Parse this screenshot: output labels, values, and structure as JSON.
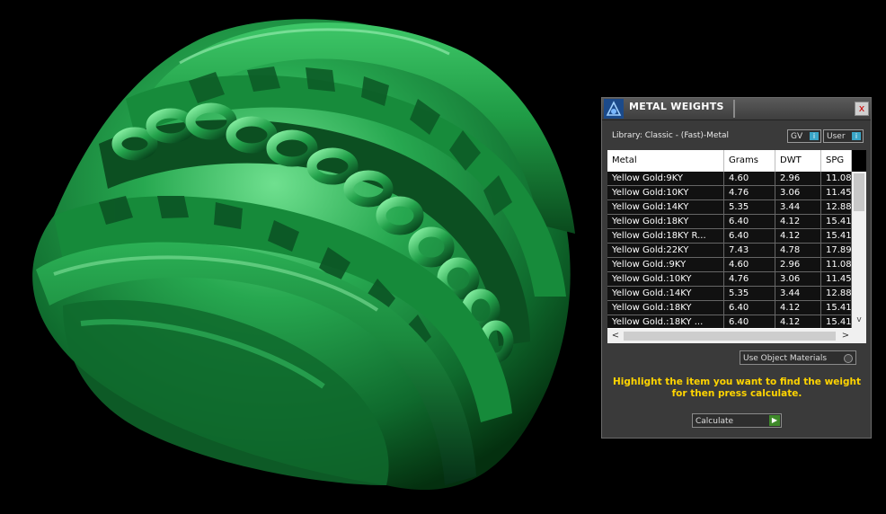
{
  "panel": {
    "title": "METAL WEIGHTS",
    "close_label": "x",
    "library_text": "Library: Classic - (Fast)-Metal",
    "gv_label": "GV",
    "user_label": "User",
    "toggle_icon": "i",
    "table": {
      "columns": [
        "Metal",
        "Grams",
        "DWT",
        "SPG"
      ],
      "rows": [
        [
          "Yellow Gold:9KY",
          "4.60",
          "2.96",
          "11.08"
        ],
        [
          "Yellow Gold:10KY",
          "4.76",
          "3.06",
          "11.45"
        ],
        [
          "Yellow Gold:14KY",
          "5.35",
          "3.44",
          "12.88"
        ],
        [
          "Yellow Gold:18KY",
          "6.40",
          "4.12",
          "15.41"
        ],
        [
          "Yellow Gold:18KY R...",
          "6.40",
          "4.12",
          "15.41"
        ],
        [
          "Yellow Gold:22KY",
          "7.43",
          "4.78",
          "17.89"
        ],
        [
          "Yellow Gold.:9KY",
          "4.60",
          "2.96",
          "11.08"
        ],
        [
          "Yellow Gold.:10KY",
          "4.76",
          "3.06",
          "11.45"
        ],
        [
          "Yellow Gold.:14KY",
          "5.35",
          "3.44",
          "12.88"
        ],
        [
          "Yellow Gold.:18KY",
          "6.40",
          "4.12",
          "15.41"
        ],
        [
          "Yellow Gold.:18KY ...",
          "6.40",
          "4.12",
          "15.41"
        ]
      ]
    },
    "scroll_left": "<",
    "scroll_right": ">",
    "scroll_down": "v",
    "use_object_materials": "Use Object Materials",
    "hint": "Highlight the item you want to find the weight for then press calculate.",
    "calculate_label": "Calculate",
    "calculate_icon": "▶"
  },
  "colors": {
    "ring": "#1f9b45",
    "hint": "#ffd400",
    "toggle_accent": "#3aa6c7"
  }
}
